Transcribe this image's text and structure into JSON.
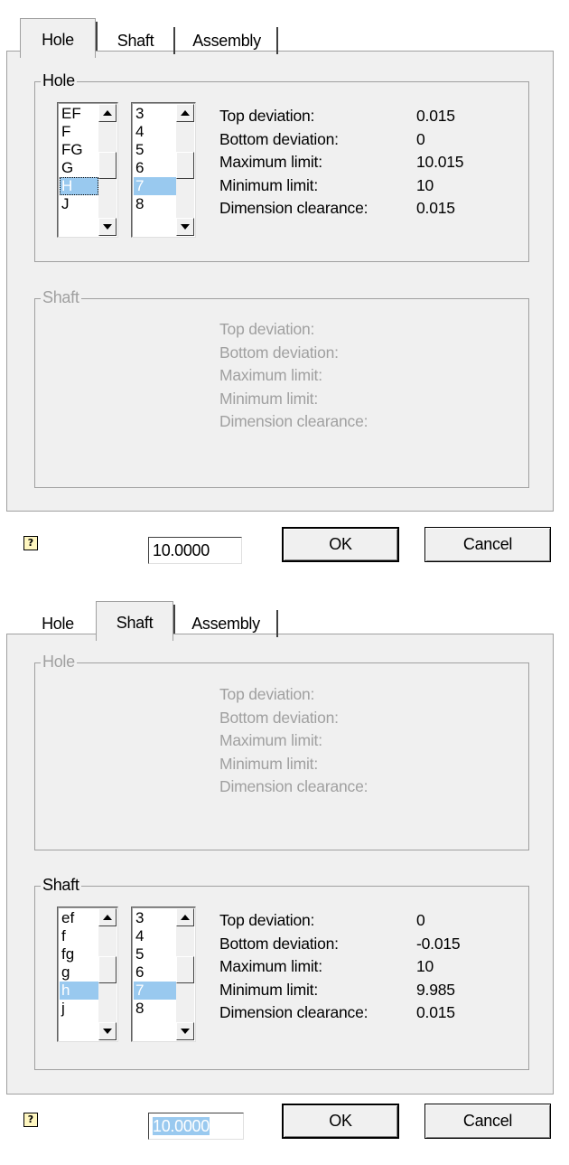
{
  "labels": [
    "Top deviation:",
    "Bottom deviation:",
    "Maximum limit:",
    "Minimum limit:",
    "Dimension clearance:"
  ],
  "dialog1": {
    "tabs": [
      "Hole",
      "Shaft",
      "Assembly"
    ],
    "active_tab": "Hole",
    "hole_group": {
      "title": "Hole",
      "letters": [
        "EF",
        "F",
        "FG",
        "G",
        "H",
        "J"
      ],
      "selected_letter": "H",
      "grades": [
        "3",
        "4",
        "5",
        "6",
        "7",
        "8"
      ],
      "selected_grade": "7",
      "values": [
        "0.015",
        "0",
        "10.015",
        "10",
        "0.015"
      ]
    },
    "shaft_group": {
      "title": "Shaft",
      "disabled": true
    },
    "help_icon": "?",
    "value": "10.0000",
    "ok_label": "OK",
    "cancel_label": "Cancel"
  },
  "dialog2": {
    "tabs": [
      "Hole",
      "Shaft",
      "Assembly"
    ],
    "active_tab": "Shaft",
    "hole_group": {
      "title": "Hole",
      "disabled": true
    },
    "shaft_group": {
      "title": "Shaft",
      "letters": [
        "ef",
        "f",
        "fg",
        "g",
        "h",
        "j"
      ],
      "selected_letter": "h",
      "grades": [
        "3",
        "4",
        "5",
        "6",
        "7",
        "8"
      ],
      "selected_grade": "7",
      "values": [
        "0",
        "-0.015",
        "10",
        "9.985",
        "0.015"
      ]
    },
    "help_icon": "?",
    "value": "10.0000",
    "ok_label": "OK",
    "cancel_label": "Cancel"
  },
  "colors": {
    "panel": "#f0f0f0",
    "selection": "#99c9ef",
    "disabled_text": "#a0a0a0"
  }
}
